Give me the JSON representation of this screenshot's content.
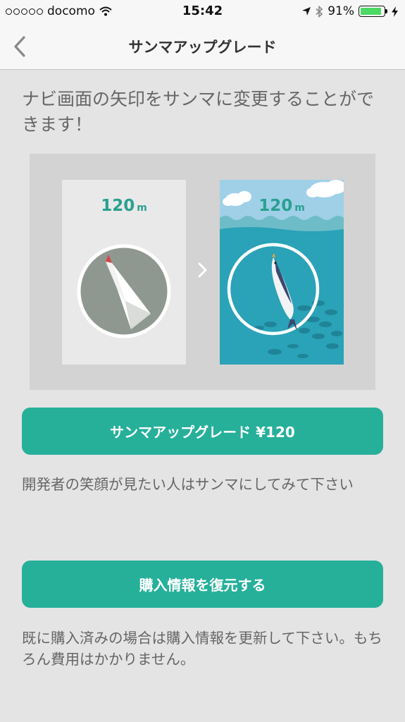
{
  "status_bar": {
    "carrier": "docomo",
    "time": "15:42",
    "battery_percent": "91%",
    "battery_level": 0.91,
    "battery_color": "#4cd964",
    "icons": [
      "signal-dots-icon",
      "wifi-icon",
      "location-arrow-icon",
      "bluetooth-icon",
      "battery-icon",
      "charging-bolt-icon"
    ]
  },
  "nav": {
    "title": "サンマアップグレード",
    "back_icon": "chevron-left-icon"
  },
  "main": {
    "intro": "ナビ画面の矢印をサンマに変更することができます！",
    "preview": {
      "before": {
        "distance": "120",
        "unit": "m",
        "icon": "compass-arrow-icon"
      },
      "between_icon": "chevron-right-icon",
      "after": {
        "distance": "120",
        "unit": "m",
        "icon": "saury-fish-icon"
      }
    },
    "upgrade_button_label": "サンマアップグレード ¥120",
    "upgrade_note": "開発者の笑顔が見たい人はサンマにしてみて下さい",
    "restore_button_label": "購入情報を復元する",
    "restore_note": "既に購入済みの場合は購入情報を更新して下さい。もちろん費用はかかりません。"
  },
  "colors": {
    "accent": "#26b09a",
    "accent_text": "#2aa090",
    "sea": "#2aa2b7",
    "background": "#e4e4e4"
  }
}
